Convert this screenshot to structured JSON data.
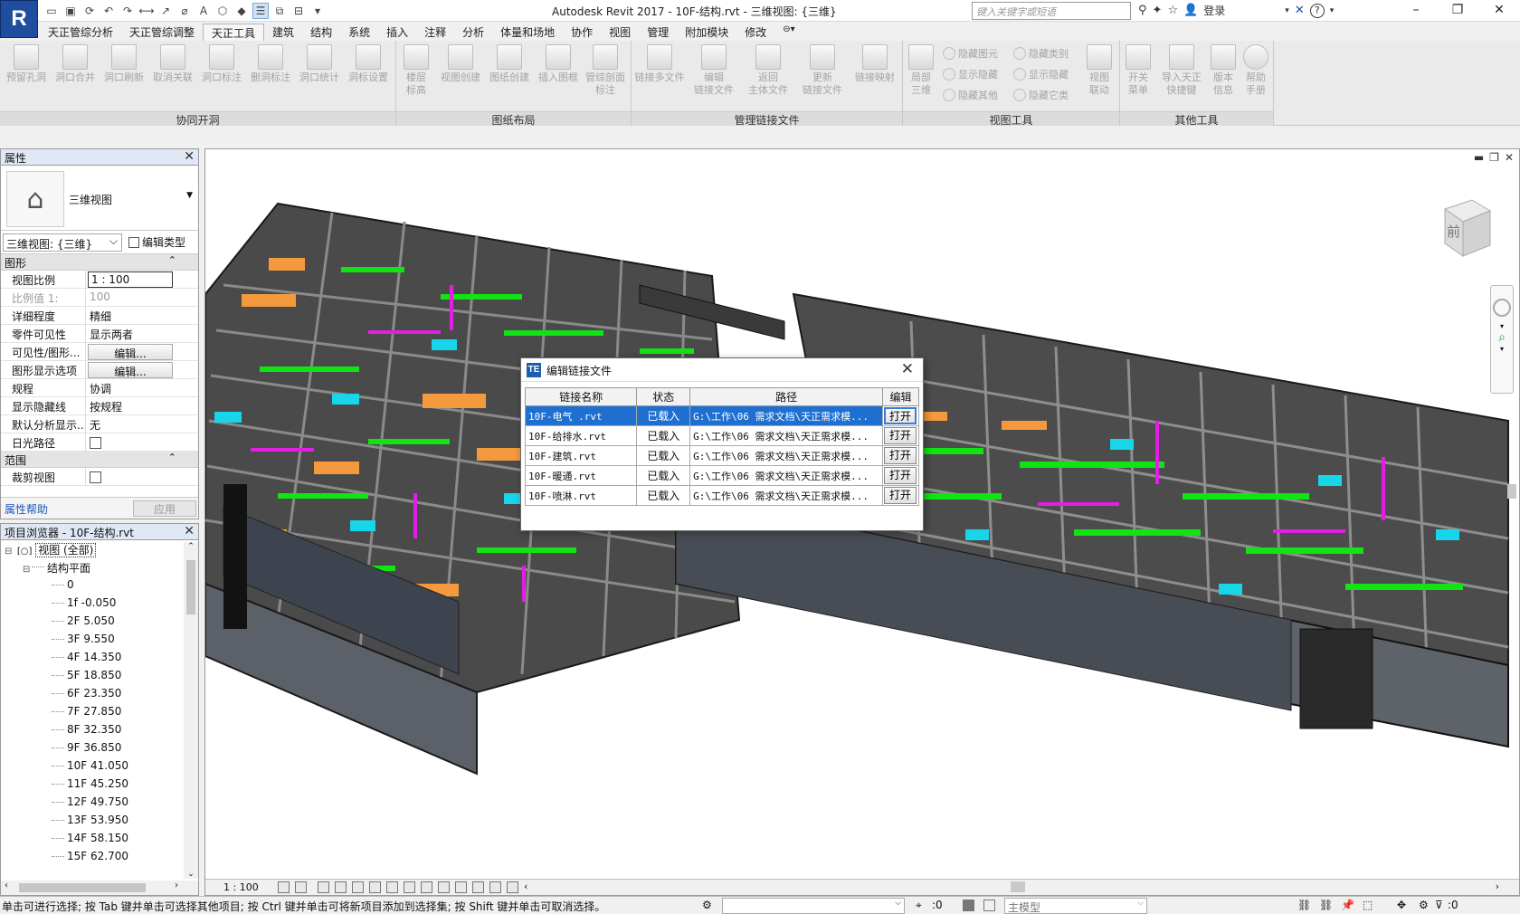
{
  "app": {
    "logo_letter": "R",
    "title": "Autodesk Revit 2017 -     10F-结构.rvt - 三维视图: {三维}",
    "search_placeholder": "键入关键字或短语",
    "login_label": "登录"
  },
  "ribbon_tabs": [
    "天正管综分析",
    "天正管综调整",
    "天正工具",
    "建筑",
    "结构",
    "系统",
    "插入",
    "注释",
    "分析",
    "体量和场地",
    "协作",
    "视图",
    "管理",
    "附加模块",
    "修改"
  ],
  "ribbon_groups": [
    {
      "title": "协同开洞",
      "buttons": [
        "预留孔洞",
        "洞口合并",
        "洞口刷新",
        "取消关联",
        "洞口标注",
        "删洞标注",
        "洞口统计",
        "洞标设置"
      ]
    },
    {
      "title": "图纸布局",
      "buttons": [
        "楼层\n标高",
        "视图创建",
        "图纸创建",
        "插入图框",
        "管综剖面\n标注"
      ]
    },
    {
      "title": "管理链接文件",
      "buttons": [
        "链接多文件",
        "编辑\n链接文件",
        "返回\n主体文件",
        "更新\n链接文件",
        "链接映射"
      ]
    },
    {
      "title": "视图工具",
      "big": [
        "局部\n三维"
      ],
      "small": [
        "隐藏图元",
        "显示隐藏",
        "隐藏其他",
        "隐藏类别",
        "显示隐藏",
        "隐藏它类"
      ],
      "end": [
        "视图\n联动"
      ]
    },
    {
      "title": "其他工具",
      "buttons": [
        "开关\n菜单",
        "导入天正\n快捷键",
        "版本\n信息",
        "帮助\n手册"
      ]
    }
  ],
  "properties": {
    "title": "属性",
    "type_name": "三维视图",
    "instance_selector": "三维视图: {三维}",
    "edit_type": "编辑类型",
    "categories": [
      {
        "name": "图形",
        "rows": [
          {
            "name": "视图比例",
            "value": "1 : 100",
            "kind": "boxed"
          },
          {
            "name": "比例值 1:",
            "value": "100",
            "kind": "disabled"
          },
          {
            "name": "详细程度",
            "value": "精细",
            "kind": "text"
          },
          {
            "name": "零件可见性",
            "value": "显示两者",
            "kind": "text"
          },
          {
            "name": "可见性/图形...",
            "value": "编辑...",
            "kind": "button"
          },
          {
            "name": "图形显示选项",
            "value": "编辑...",
            "kind": "button"
          },
          {
            "name": "规程",
            "value": "协调",
            "kind": "text"
          },
          {
            "name": "显示隐藏线",
            "value": "按规程",
            "kind": "text"
          },
          {
            "name": "默认分析显示...",
            "value": "无",
            "kind": "text"
          },
          {
            "name": "日光路径",
            "value": "",
            "kind": "checkbox"
          }
        ]
      },
      {
        "name": "范围",
        "rows": [
          {
            "name": "裁剪视图",
            "value": "",
            "kind": "checkbox"
          }
        ]
      }
    ],
    "help_link": "属性帮助",
    "apply_label": "应用"
  },
  "browser": {
    "title": "项目浏览器 - 10F-结构.rvt",
    "root": "视图 (全部)",
    "group": "结构平面",
    "levels": [
      "0",
      "1f  -0.050",
      "2F 5.050",
      "3F 9.550",
      "4F 14.350",
      "5F 18.850",
      "6F 23.350",
      "7F 27.850",
      "8F 32.350",
      "9F 36.850",
      "10F 41.050",
      "11F 45.250",
      "12F 49.750",
      "13F 53.950",
      "14F 58.150",
      "15F 62.700"
    ]
  },
  "viewport": {
    "scale_label": "1 : 100",
    "cube_face": "前"
  },
  "dialog": {
    "title": "编辑链接文件",
    "columns": [
      "链接名称",
      "状态",
      "路径",
      "编辑"
    ],
    "rows": [
      {
        "name": "10F-电气 .rvt",
        "status": "已载入",
        "path": "G:\\工作\\06 需求文档\\天正需求模...",
        "action": "打开"
      },
      {
        "name": "10F-给排水.rvt",
        "status": "已载入",
        "path": "G:\\工作\\06 需求文档\\天正需求模...",
        "action": "打开"
      },
      {
        "name": "10F-建筑.rvt",
        "status": "已载入",
        "path": "G:\\工作\\06 需求文档\\天正需求模...",
        "action": "打开"
      },
      {
        "name": "10F-暖通.rvt",
        "status": "已载入",
        "path": "G:\\工作\\06 需求文档\\天正需求模...",
        "action": "打开"
      },
      {
        "name": "10F-喷淋.rvt",
        "status": "已载入",
        "path": "G:\\工作\\06 需求文档\\天正需求模...",
        "action": "打开"
      }
    ],
    "selected_row": 0
  },
  "statusbar": {
    "text": "单击可进行选择; 按 Tab 键并单击可选择其他项目; 按 Ctrl 键并单击可将新项目添加到选择集; 按 Shift 键并单击可取消选择。",
    "selection_count": ":0",
    "model_selector": "主模型",
    "filter_count": ":0"
  },
  "colors": {
    "mep_green": "#12e312",
    "mep_cyan": "#18d6ea",
    "mep_magenta": "#e21ee2",
    "mep_orange": "#f59a3c",
    "structure_gray": "#5c5c5c",
    "selection_blue": "#1e6fd0"
  }
}
